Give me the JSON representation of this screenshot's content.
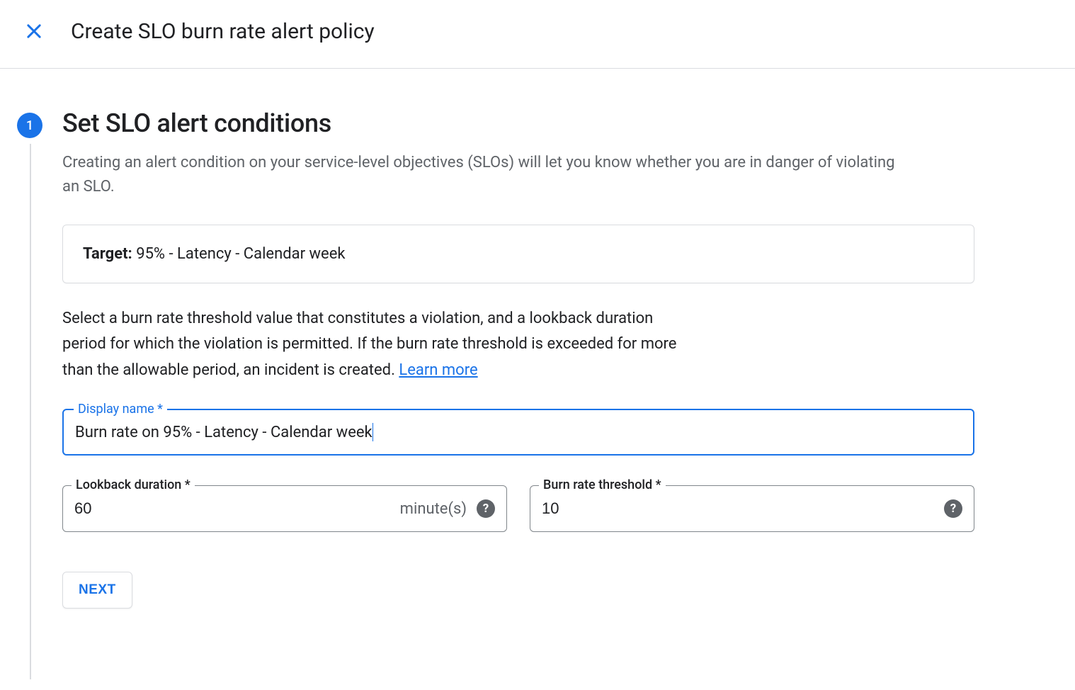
{
  "header": {
    "title": "Create SLO burn rate alert policy"
  },
  "step": {
    "number": "1",
    "title": "Set SLO alert conditions",
    "description": "Creating an alert condition on your service-level objectives (SLOs) will let you know whether you are in danger of violating an SLO.",
    "target_label": "Target:",
    "target_value": " 95% - Latency - Calendar week",
    "instruction": "Select a burn rate threshold value that constitutes a violation, and a lookback duration period for which the violation is permitted. If the burn rate threshold is exceeded for more than the allowable period, an incident is created. ",
    "learn_more": "Learn more"
  },
  "fields": {
    "display_name": {
      "label": "Display name *",
      "value": "Burn rate on 95% - Latency - Calendar week"
    },
    "lookback": {
      "label": "Lookback duration *",
      "value": "60",
      "suffix": "minute(s)"
    },
    "threshold": {
      "label": "Burn rate threshold *",
      "value": "10"
    }
  },
  "buttons": {
    "next": "NEXT"
  }
}
